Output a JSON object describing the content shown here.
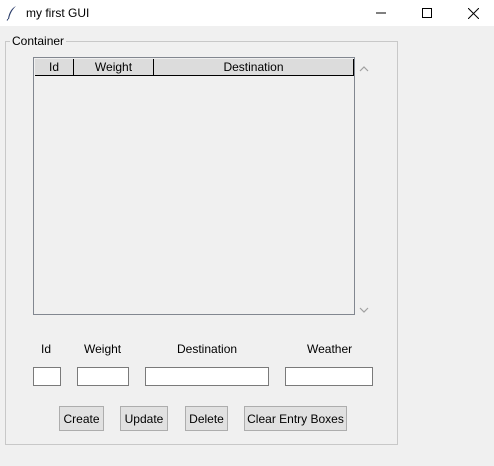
{
  "window": {
    "title": "my first GUI",
    "icons": {
      "app": "feather-icon",
      "minimize": "minimize-icon",
      "maximize": "maximize-icon",
      "close": "close-icon"
    }
  },
  "container": {
    "label": "Container",
    "table": {
      "columns": [
        "Id",
        "Weight",
        "Destination"
      ],
      "rows": []
    }
  },
  "form": {
    "labels": {
      "id": "Id",
      "weight": "Weight",
      "destination": "Destination",
      "weather": "Weather"
    },
    "values": {
      "id": "",
      "weight": "",
      "destination": "",
      "weather": ""
    }
  },
  "buttons": {
    "create": "Create",
    "update": "Update",
    "delete": "Delete",
    "clear": "Clear Entry Boxes"
  }
}
